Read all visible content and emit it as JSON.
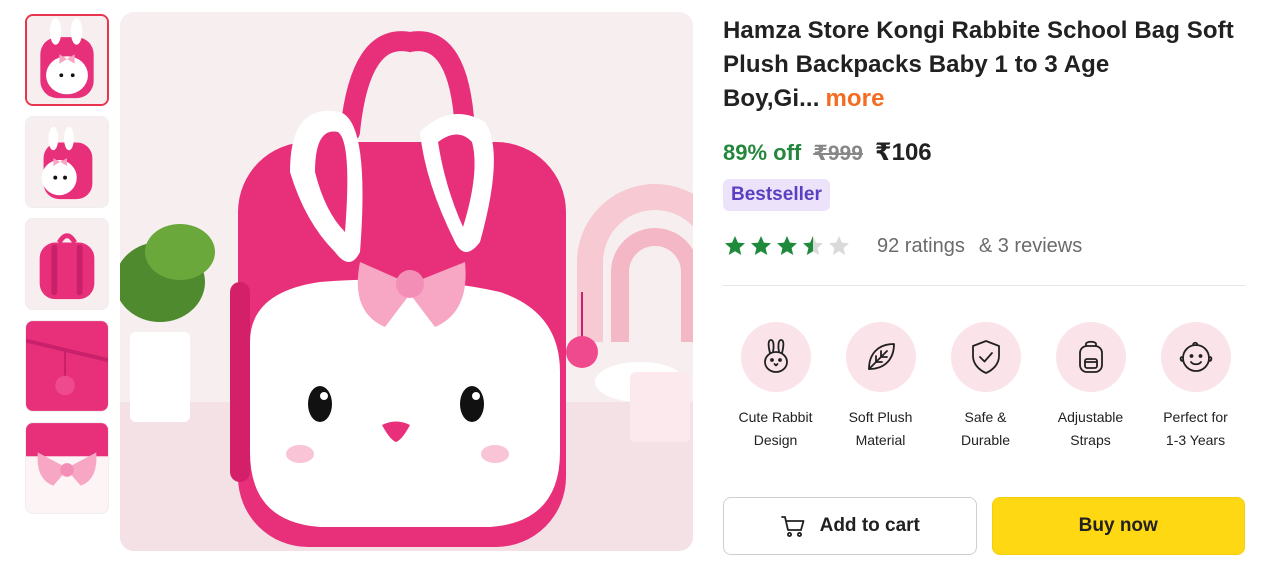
{
  "product": {
    "title": "Hamza Store Kongi Rabbite School Bag Soft Plush Backpacks Baby 1 to 3 Age Boy,Gi...",
    "more_label": "more",
    "discount": "89% off",
    "mrp": "₹999",
    "price": "₹106",
    "badge": "Bestseller",
    "rating": 3.5,
    "ratings_text": "92 ratings",
    "reviews_text": "& 3 reviews"
  },
  "thumbnails": [
    {
      "name": "thumb-front-view"
    },
    {
      "name": "thumb-side-view"
    },
    {
      "name": "thumb-back-view"
    },
    {
      "name": "thumb-zipper-closeup"
    },
    {
      "name": "thumb-bow-closeup"
    }
  ],
  "features": [
    {
      "icon": "rabbit-icon",
      "line1": "Cute Rabbit",
      "line2": "Design"
    },
    {
      "icon": "leaf-icon",
      "line1": "Soft Plush",
      "line2": "Material"
    },
    {
      "icon": "shield-check-icon",
      "line1": "Safe &",
      "line2": "Durable"
    },
    {
      "icon": "backpack-icon",
      "line1": "Adjustable",
      "line2": "Straps"
    },
    {
      "icon": "baby-face-icon",
      "line1": "Perfect for",
      "line2": "1-3 Years"
    }
  ],
  "actions": {
    "add_to_cart": "Add to cart",
    "buy_now": "Buy now"
  },
  "colors": {
    "discount": "#23883d",
    "more_link": "#f36c21",
    "badge_bg": "#ece3fb",
    "badge_text": "#5a3fc0",
    "star": "#1f8a3b",
    "buy_button": "#ffd814",
    "feature_circle": "#fbe3ea",
    "bag_pink": "#e8307a"
  }
}
